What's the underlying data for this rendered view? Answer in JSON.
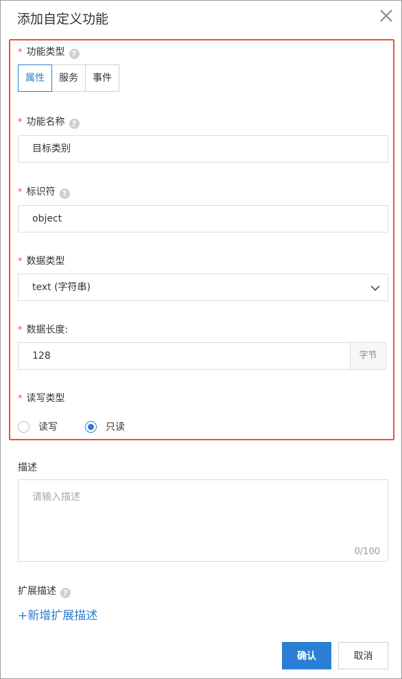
{
  "dialog": {
    "title": "添加自定义功能",
    "close_icon": "close-icon"
  },
  "form": {
    "required_mark": "*",
    "help_glyph": "?",
    "function_type": {
      "label": "功能类型",
      "options": [
        "属性",
        "服务",
        "事件"
      ],
      "selected": "属性"
    },
    "function_name": {
      "label": "功能名称",
      "value": "目标类别"
    },
    "identifier": {
      "label": "标识符",
      "value": "object"
    },
    "data_type": {
      "label": "数据类型",
      "value": "text (字符串)"
    },
    "data_length": {
      "label": "数据长度:",
      "value": "128",
      "unit": "字节"
    },
    "rw_type": {
      "label": "读写类型",
      "options": [
        "读写",
        "只读"
      ],
      "selected": "只读"
    },
    "description": {
      "label": "描述",
      "placeholder": "请输入描述",
      "counter": "0/100"
    },
    "extended": {
      "label": "扩展描述",
      "add_link": "+新增扩展描述"
    }
  },
  "footer": {
    "confirm": "确认",
    "cancel": "取消"
  },
  "colors": {
    "accent": "#2a7fd4",
    "required": "#e8532f",
    "highlight_border": "#e8532f"
  }
}
